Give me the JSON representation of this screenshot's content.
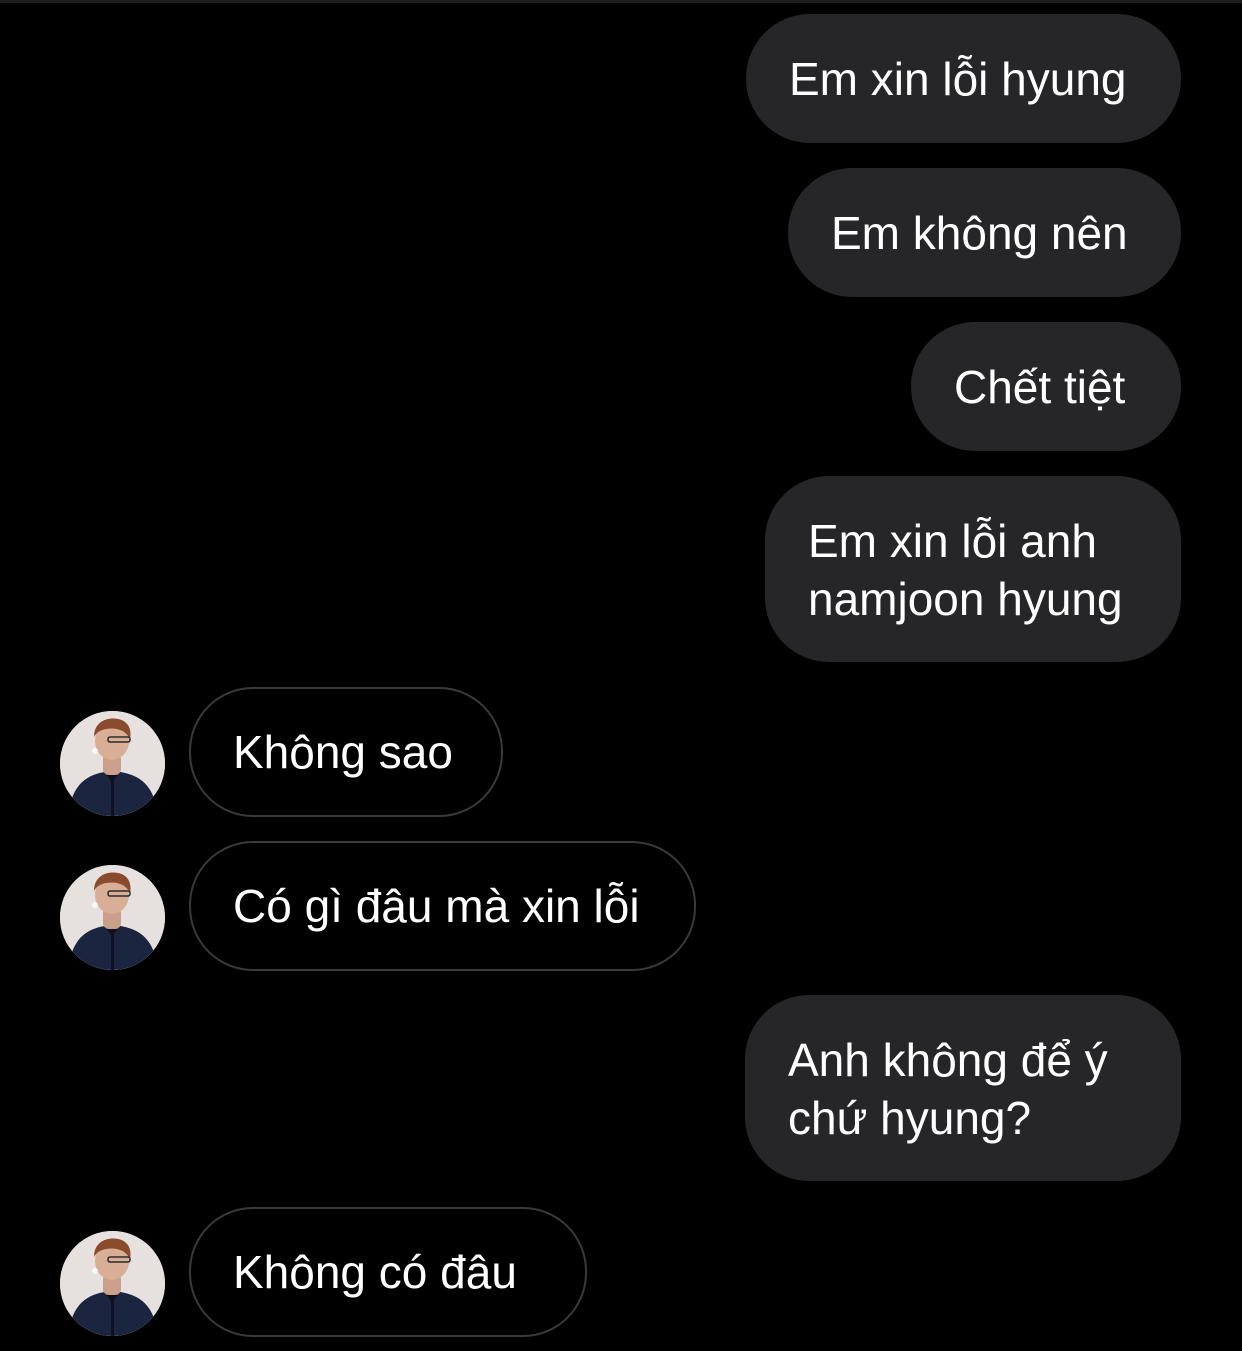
{
  "colors": {
    "background": "#000000",
    "sent_bubble": "#262628",
    "received_border": "#3a3a3c",
    "text": "#ffffff"
  },
  "messages": [
    {
      "direction": "sent",
      "text": "Em xin lỗi hyung"
    },
    {
      "direction": "sent",
      "text": "Em không nên"
    },
    {
      "direction": "sent",
      "text": "Chết tiệt"
    },
    {
      "direction": "sent",
      "text": "Em xin lỗi anh namjoon hyung"
    },
    {
      "direction": "received",
      "text": "Không sao",
      "avatar": "contact-avatar"
    },
    {
      "direction": "received",
      "text": "Có gì đâu mà xin lỗi",
      "avatar": "contact-avatar"
    },
    {
      "direction": "sent",
      "text": "Anh không để ý chứ hyung?"
    },
    {
      "direction": "received",
      "text": "Không có đâu",
      "avatar": "contact-avatar"
    }
  ]
}
